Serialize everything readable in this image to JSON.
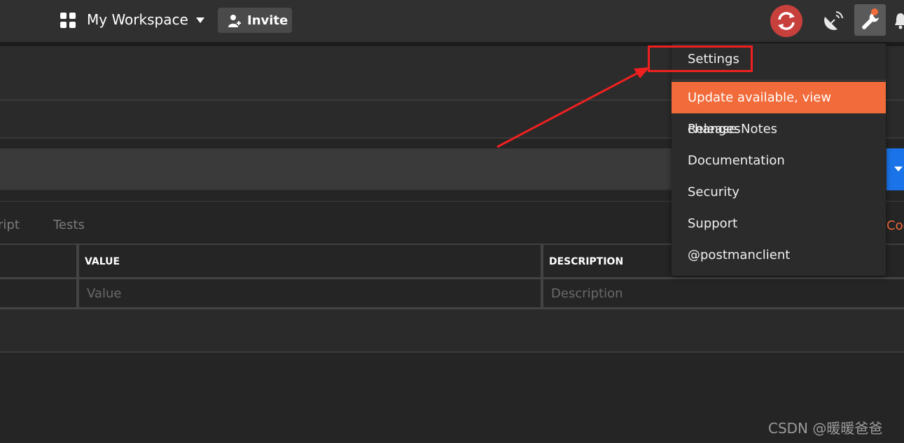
{
  "header": {
    "workspace_label": "My Workspace",
    "invite_label": "Invite",
    "icons": [
      "workspace-grid-icon",
      "chevron-down-icon",
      "add-user-icon",
      "sync-icon",
      "satellite-icon",
      "wrench-icon",
      "bell-icon"
    ]
  },
  "request": {
    "tabs": [
      "ript",
      "Tests"
    ],
    "code_link": "Coo"
  },
  "params_table": {
    "columns": [
      "VALUE",
      "DESCRIPTION"
    ],
    "placeholders": [
      "Value",
      "Description"
    ]
  },
  "settings_menu": {
    "items": [
      {
        "label": "Settings"
      },
      {
        "label": "Update available, view changes",
        "highlight": true
      },
      {
        "label": "Release Notes"
      },
      {
        "label": "Documentation"
      },
      {
        "label": "Security"
      },
      {
        "label": "Support"
      },
      {
        "label": "@postmanclient"
      }
    ]
  },
  "annotation": {
    "box_color": "#f02020",
    "target": "Settings"
  },
  "watermark": "CSDN @暖暖爸爸",
  "colors": {
    "accent": "#f26b3a",
    "send_blue": "#1a73e8",
    "sync_red": "#c8403c"
  }
}
